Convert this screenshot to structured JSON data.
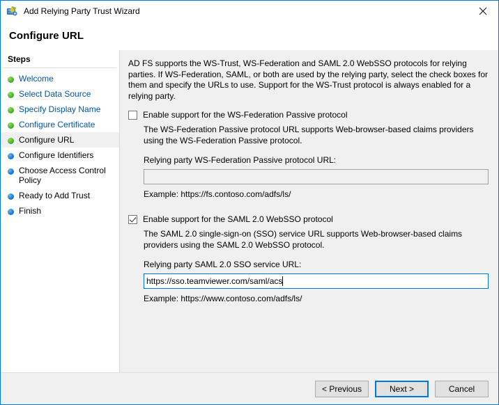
{
  "window": {
    "title": "Add Relying Party Trust Wizard",
    "icon": "adfs-wizard-icon",
    "close_label": "close-icon"
  },
  "header": {
    "title": "Configure URL"
  },
  "sidebar": {
    "heading": "Steps",
    "items": [
      {
        "label": "Welcome",
        "state": "done"
      },
      {
        "label": "Select Data Source",
        "state": "done"
      },
      {
        "label": "Specify Display Name",
        "state": "done"
      },
      {
        "label": "Configure Certificate",
        "state": "done"
      },
      {
        "label": "Configure URL",
        "state": "current"
      },
      {
        "label": "Configure Identifiers",
        "state": "todo"
      },
      {
        "label": "Choose Access Control Policy",
        "state": "todo"
      },
      {
        "label": "Ready to Add Trust",
        "state": "todo"
      },
      {
        "label": "Finish",
        "state": "todo"
      }
    ]
  },
  "content": {
    "intro": "AD FS supports the WS-Trust, WS-Federation and SAML 2.0 WebSSO protocols for relying parties.  If WS-Federation, SAML, or both are used by the relying party, select the check boxes for them and specify the URLs to use.  Support for the WS-Trust protocol is always enabled for a relying party.",
    "wsfed": {
      "checkbox_label": "Enable support for the WS-Federation Passive protocol",
      "checked": false,
      "description": "The WS-Federation Passive protocol URL supports Web-browser-based claims providers using the WS-Federation Passive protocol.",
      "field_label": "Relying party WS-Federation Passive protocol URL:",
      "value": "",
      "example": "Example: https://fs.contoso.com/adfs/ls/"
    },
    "saml": {
      "checkbox_label": "Enable support for the SAML 2.0 WebSSO protocol",
      "checked": true,
      "description": "The SAML 2.0 single-sign-on (SSO) service URL supports Web-browser-based claims providers using the SAML 2.0 WebSSO protocol.",
      "field_label": "Relying party SAML 2.0 SSO service URL:",
      "value": "https://sso.teamviewer.com/saml/acs",
      "example": "Example: https://www.contoso.com/adfs/ls/"
    }
  },
  "buttons": {
    "previous": "< Previous",
    "next": "Next >",
    "cancel": "Cancel"
  },
  "colors": {
    "accent": "#0078d7",
    "link": "#0054a6",
    "panel": "#f0f0f0",
    "done_bullet": "#4cb72b",
    "todo_bullet": "#1e7fd4"
  }
}
